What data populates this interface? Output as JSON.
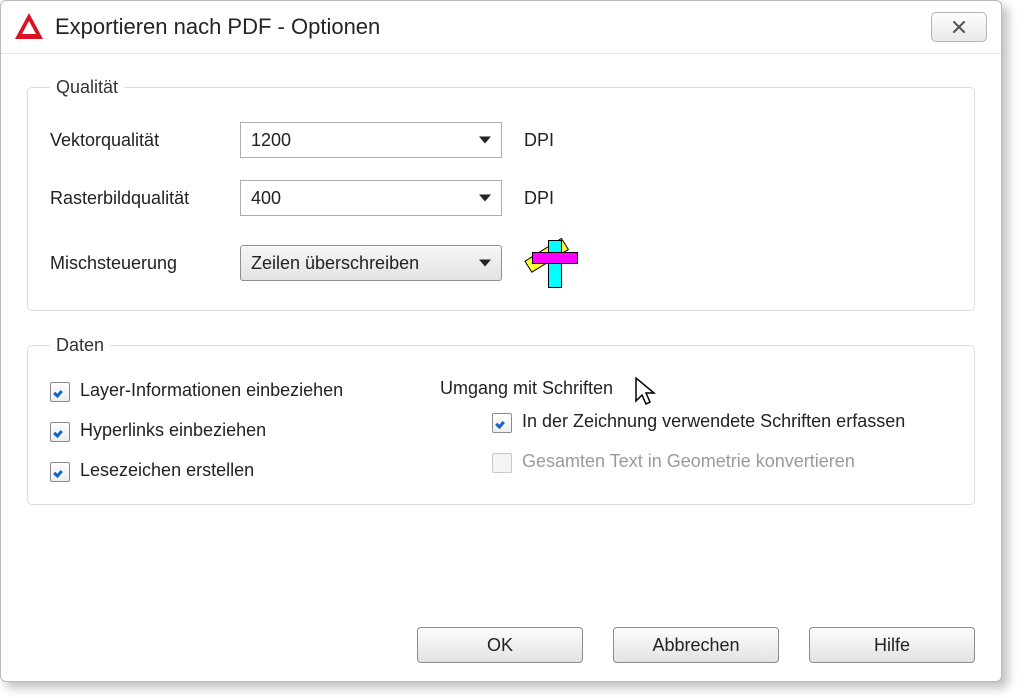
{
  "window": {
    "title": "Exportieren nach PDF - Optionen"
  },
  "quality": {
    "legend": "Qualität",
    "vector_label": "Vektorqualität",
    "vector_value": "1200",
    "vector_unit": "DPI",
    "raster_label": "Rasterbildqualität",
    "raster_value": "400",
    "raster_unit": "DPI",
    "merge_label": "Mischsteuerung",
    "merge_value": "Zeilen überschreiben"
  },
  "data": {
    "legend": "Daten",
    "include_layer_info": "Layer-Informationen einbeziehen",
    "include_hyperlinks": "Hyperlinks einbeziehen",
    "create_bookmarks": "Lesezeichen erstellen",
    "font_handling_heading": "Umgang mit Schriften",
    "capture_fonts": "In der Zeichnung verwendete Schriften erfassen",
    "convert_text_geometry": "Gesamten Text in Geometrie konvertieren"
  },
  "buttons": {
    "ok": "OK",
    "cancel": "Abbrechen",
    "help": "Hilfe"
  }
}
